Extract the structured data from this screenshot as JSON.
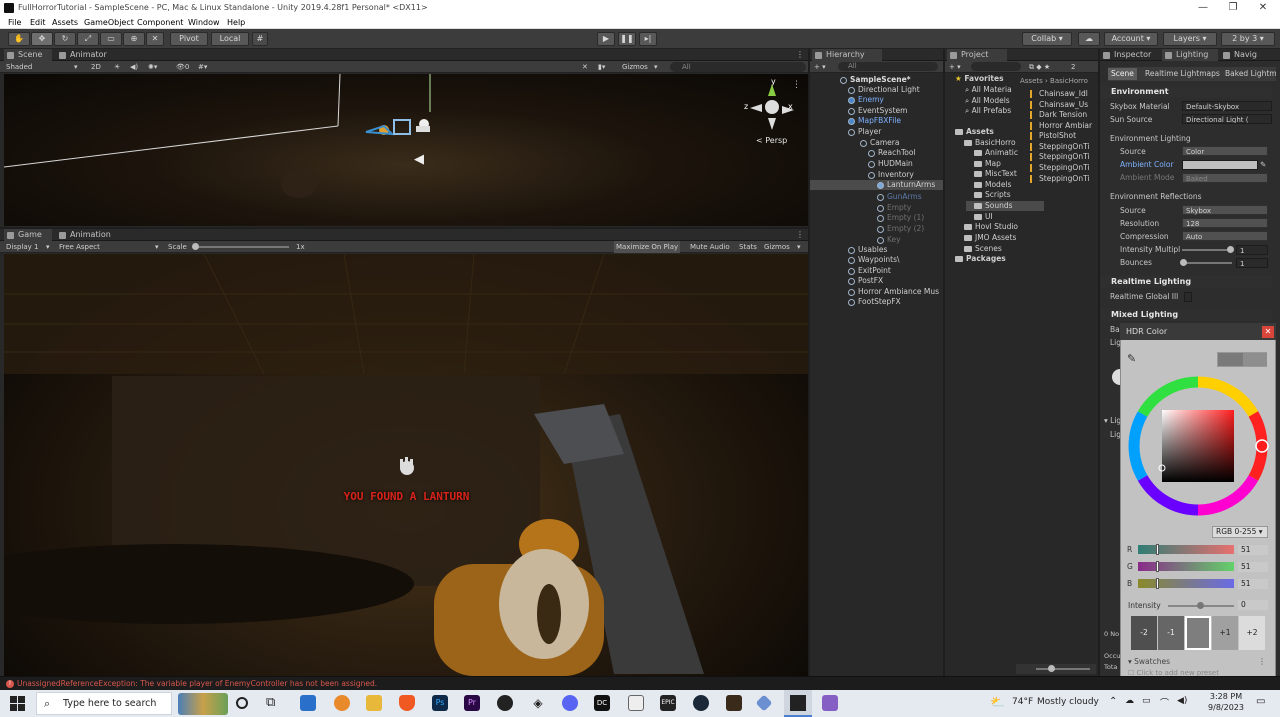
{
  "window": {
    "title": "FullHorrorTutorial - SampleScene - PC, Mac & Linux Standalone - Unity 2019.4.28f1 Personal* <DX11>",
    "minimize": "—",
    "maximize": "❐",
    "close": "✕"
  },
  "menu": [
    "File",
    "Edit",
    "Assets",
    "GameObject",
    "Component",
    "Window",
    "Help"
  ],
  "toolbar": {
    "pivot": "Pivot",
    "local": "Local",
    "collab": "Collab ▾",
    "account": "Account ▾",
    "layers": "Layers ▾",
    "layout": "2 by 3 ▾"
  },
  "scene": {
    "tab_scene": "Scene",
    "tab_animator": "Animator",
    "shading": "Shaded",
    "mode2d": "2D",
    "gizmos": "Gizmos",
    "search_placeholder": "All",
    "persp": "< Persp",
    "axis_z": "z",
    "axis_x": "x",
    "axis_y": "y"
  },
  "game": {
    "tab_game": "Game",
    "tab_animation": "Animation",
    "display": "Display 1",
    "aspect": "Free Aspect",
    "scale_label": "Scale",
    "scale_value": "1x",
    "maximize_on_play": "Maximize On Play",
    "mute_audio": "Mute Audio",
    "stats": "Stats",
    "gizmos": "Gizmos",
    "message": "YOU FOUND A LANTURN"
  },
  "hierarchy": {
    "title": "Hierarchy",
    "search_placeholder": "All",
    "items": [
      {
        "label": "SampleScene*",
        "style": "scene"
      },
      {
        "label": "Directional Light",
        "style": ""
      },
      {
        "label": "Enemy",
        "style": "blue"
      },
      {
        "label": "EventSystem",
        "style": ""
      },
      {
        "label": "MapFBXFile",
        "style": "blue"
      },
      {
        "label": "Player",
        "style": ""
      },
      {
        "label": "Camera",
        "style": ""
      },
      {
        "label": "ReachTool",
        "style": ""
      },
      {
        "label": "HUDMain",
        "style": ""
      },
      {
        "label": "Inventory",
        "style": ""
      },
      {
        "label": "LanturnArms",
        "style": "sel"
      },
      {
        "label": "GunArms",
        "style": "dimblue"
      },
      {
        "label": "Empty",
        "style": "dim"
      },
      {
        "label": "Empty (1)",
        "style": "dim"
      },
      {
        "label": "Empty (2)",
        "style": "dim"
      },
      {
        "label": "Key",
        "style": "dim"
      },
      {
        "label": "Usables",
        "style": ""
      },
      {
        "label": "Waypoints\\",
        "style": ""
      },
      {
        "label": "ExitPoint",
        "style": ""
      },
      {
        "label": "PostFX",
        "style": ""
      },
      {
        "label": "Horror Ambiance Mus",
        "style": ""
      },
      {
        "label": "FootStepFX",
        "style": ""
      }
    ]
  },
  "project": {
    "title": "Project",
    "badge": "2",
    "favorites": "Favorites",
    "fav_items": [
      "All Materia",
      "All Models",
      "All Prefabs"
    ],
    "assets": "Assets",
    "tree": [
      "BasicHorro",
      "Animatic",
      "Map",
      "MiscText",
      "Models",
      "Scripts",
      "Sounds",
      "UI",
      "Hovl Studio",
      "JMO Assets",
      "Scenes"
    ],
    "packages": "Packages",
    "breadcrumb": "Assets › BasicHorro",
    "files": [
      "Chainsaw_Idl",
      "Chainsaw_Us",
      "Dark Tension",
      "Horror Ambiar",
      "PistolShot",
      "SteppingOnTi",
      "SteppingOnTi",
      "SteppingOnTi",
      "SteppingOnTi"
    ]
  },
  "inspector": {
    "tab_inspector": "Inspector",
    "tab_lighting": "Lighting",
    "tab_navig": "Navig",
    "subtab_scene": "Scene",
    "subtab_realtime": "Realtime Lightmaps",
    "subtab_baked": "Baked Lightmaps",
    "environment": "Environment",
    "skybox_material_label": "Skybox Material",
    "skybox_material_value": "Default-Skybox",
    "sun_source_label": "Sun Source",
    "sun_source_value": "Directional Light (",
    "env_lighting": "Environment Lighting",
    "source_label": "Source",
    "source_value": "Color",
    "ambient_color_label": "Ambient Color",
    "ambient_mode_label": "Ambient Mode",
    "ambient_mode_value": "Baked",
    "env_reflections": "Environment Reflections",
    "refl_source_value": "Skybox",
    "resolution_label": "Resolution",
    "resolution_value": "128",
    "compression_label": "Compression",
    "compression_value": "Auto",
    "intensity_mult_label": "Intensity Multipl",
    "intensity_mult_value": "1",
    "bounces_label": "Bounces",
    "bounces_value": "1",
    "realtime_lighting": "Realtime Lighting",
    "realtime_gi_label": "Realtime Global Ill",
    "mixed_lighting": "Mixed Lighting",
    "frag1": "Ba",
    "frag2": "Lig",
    "frag3": "Lig",
    "frag4": "Lig",
    "frag5": "0 No",
    "frag6": "Occu",
    "frag7": "Tota"
  },
  "hdr_color": {
    "title": "HDR Color",
    "mode": "RGB 0-255 ▾",
    "r_label": "R",
    "r_value": "51",
    "g_label": "G",
    "g_value": "51",
    "b_label": "B",
    "b_value": "51",
    "intensity_label": "Intensity",
    "intensity_value": "0",
    "stops": [
      "-2",
      "-1",
      "",
      "+1",
      "+2"
    ],
    "swatches": "Swatches",
    "add_preset": "Click to add new preset"
  },
  "status": {
    "error": "UnassignedReferenceException: The variable player of EnemyController has not been assigned."
  },
  "taskbar": {
    "search_placeholder": "Type here to search",
    "weather_temp": "74°F",
    "weather_text": "Mostly cloudy",
    "time": "3:28 PM",
    "date": "9/8/2023"
  },
  "colors": {
    "accent_blue": "#7fb2ff",
    "error_red": "#d8574c",
    "ambient_swatch": "#bdbdbd",
    "lantern_orange": "#c9821f"
  }
}
